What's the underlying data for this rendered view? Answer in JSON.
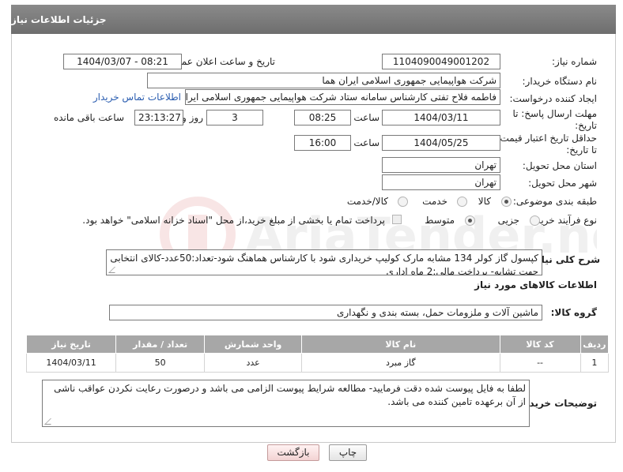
{
  "header": {
    "title": "جزئیات اطلاعات نیاز"
  },
  "fields": {
    "need_number_label": "شماره نیاز:",
    "need_number": "1104090049001202",
    "announce_label": "تاریخ و ساعت اعلان عمومی:",
    "announce_value": "1404/03/07 - 08:21",
    "buyer_org_label": "نام دستگاه خریدار:",
    "buyer_org": "شرکت هواپیمایی جمهوری اسلامی ایران هما",
    "creator_label": "ایجاد کننده درخواست:",
    "creator": "فاطمه فلاح تفتی کارشناس سامانه ستاد شرکت هواپیمایی جمهوری اسلامی ایران هما",
    "contact_link": "اطلاعات تماس خریدار",
    "deadline_label_1": "مهلت ارسال پاسخ: تا",
    "deadline_label_2": "تاریخ:",
    "deadline_date": "1404/03/11",
    "time_label": "ساعت",
    "deadline_time": "08:25",
    "days_value": "3",
    "days_label": "روز و",
    "remaining_time": "23:13:27",
    "remaining_label": "ساعت باقی مانده",
    "min_validity_label_1": "حداقل تاریخ اعتبار قیمت:",
    "min_validity_label_2": "تا تاریخ:",
    "validity_date": "1404/05/25",
    "validity_time_label": "ساعت",
    "validity_time": "16:00",
    "province_label": "استان محل تحویل:",
    "province": "تهران",
    "city_label": "شهر محل تحویل:",
    "city": "تهران",
    "category_label": "طبقه بندی موضوعی:",
    "category_options": [
      "کالا",
      "خدمت",
      "کالا/خدمت"
    ],
    "process_label": "نوع فرآیند خرید :",
    "process_options": [
      "جزیی",
      "متوسط"
    ],
    "treasury_note": "پرداخت تمام یا بخشی از مبلغ خرید،از محل \"اسناد خزانه اسلامی\" خواهد بود."
  },
  "description": {
    "label": "شرح کلی نیاز:",
    "text": "کپسول گاز کولر 134 مشابه مارک کولیپ خریداری شود با کارشناس هماهنگ شود-تعداد:50عدد-کالای انتخابی جهت تشابه- پرداخت مالی:2 ماه اداری"
  },
  "goods": {
    "section_title": "اطلاعات کالاهای مورد نیاز",
    "group_label": "گروه کالا:",
    "group_value": "ماشین آلات و ملزومات حمل، بسته بندی و نگهداری",
    "columns": [
      "ردیف",
      "کد کالا",
      "نام کالا",
      "واحد شمارش",
      "تعداد / مقدار",
      "تاریخ نیاز"
    ],
    "rows": [
      [
        "1",
        "--",
        "گاز مبرد",
        "عدد",
        "50",
        "1404/03/11"
      ]
    ]
  },
  "buyer_notes": {
    "label": "توضیحات خریدار:",
    "text": "لطفا به فایل پیوست شده دقت فرمایید- مطالعه شرایط پیوست الزامی می باشد و درصورت رعایت نکردن عواقب ناشی از آن برعهده تامین کننده می باشد."
  },
  "buttons": {
    "print": "چاپ",
    "back": "بازگشت"
  },
  "watermark": "AriaTender.neT"
}
